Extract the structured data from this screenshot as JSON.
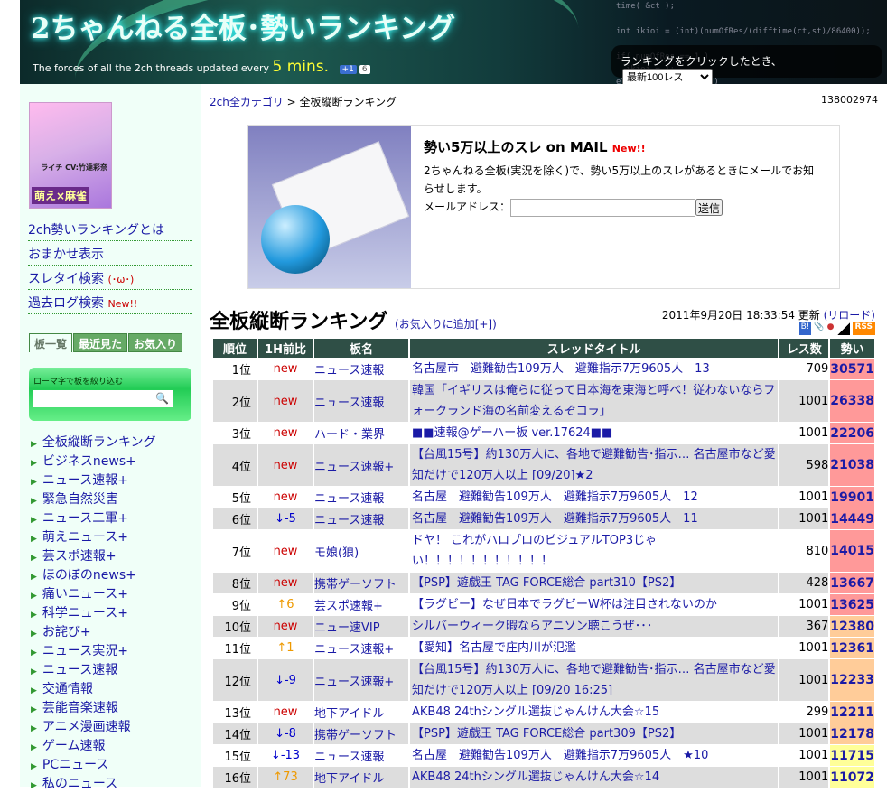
{
  "header": {
    "title": "2ちゃんねる全板･勢いランキング",
    "tagline_prefix": "The forces of all the 2ch threads updated every",
    "tagline_mins": "5 mins.",
    "gplus_label": "+1",
    "gplus_count": "6",
    "click_pref_label": "ランキングをクリックしたとき、",
    "click_pref_value": "最新100レス",
    "code": "time( &ct );\n\nint ikioi = (int)(numOfRes/(difftime(ct,st)/86400));\n\nif( numOfRes == 1 )\n  ikioi = 1;\nelse if( ikioi > 10 )\n  ikioi = ikioi > 10 ? 10 : ikioi;"
  },
  "sidebar": {
    "banner_text": "萌え×麻雀",
    "banner_cv": "ライチ CV:竹達彩奈",
    "links": [
      {
        "label": "2ch勢いランキングとは"
      },
      {
        "label": "おまかせ表示"
      },
      {
        "label": "スレタイ検索",
        "extra": "(･ω･)"
      },
      {
        "label": "過去ログ検索",
        "extra": "New!!"
      }
    ],
    "tabs": [
      "板一覧",
      "最近見た",
      "お気入り"
    ],
    "filter_label": "ローマ字で板を絞り込む",
    "boards": [
      "全板縦断ランキング",
      "ビジネスnews+",
      "ニュース速報+",
      "緊急自然災害",
      "ニュース二軍+",
      "萌えニュース+",
      "芸スポ速報+",
      "ほのぼのnews+",
      "痛いニュース+",
      "科学ニュース+",
      "お詫び+",
      "ニュース実況+",
      "ニュース速報",
      "交通情報",
      "芸能音楽速報",
      "アニメ漫画速報",
      "ゲーム速報",
      "PCニュース",
      "私のニュース"
    ]
  },
  "main": {
    "breadcrumb_link": "2ch全カテゴリ",
    "breadcrumb_sep": " > ",
    "breadcrumb_current": "全板縦断ランキング",
    "counter": "138002974",
    "mail": {
      "title": "勢い5万以上のスレ on MAIL",
      "new": "New!!",
      "desc": "2ちゃんねる全板(実況を除く)で、勢い5万以上のスレがあるときにメールでお知らせします。",
      "address_label": "メールアドレス：",
      "send": "送信"
    },
    "ranking_title": "全板縦断ランキング",
    "fav_link": "(お気入りに追加[+])",
    "updated": "2011年9月20日 18:33:54 更新",
    "reload": "(リロード)",
    "rss": "RSS",
    "columns": [
      "順位",
      "1H前比",
      "板名",
      "スレッドタイトル",
      "レス数",
      "勢い"
    ],
    "colors": {
      "pink": "#ff9999",
      "orange": "#ffcc99",
      "yellow": "#ffff99",
      "header": "#2f4f46"
    },
    "rows": [
      {
        "rank": "1位",
        "chg": "new",
        "board": "ニュース速報",
        "title": "名古屋市　避難勧告109万人　避難指示7万9605人　13",
        "res": "709",
        "ikioi": "30571"
      },
      {
        "rank": "2位",
        "chg": "new",
        "board": "ニュース速報",
        "title": "韓国「イギリスは俺らに従って日本海を東海と呼べ！従わないならフォークランド海の名前変えるぞコラ」",
        "res": "1001",
        "ikioi": "26338"
      },
      {
        "rank": "3位",
        "chg": "new",
        "board": "ハード・業界",
        "title": "■■速報@ゲーハー板 ver.17624■■",
        "res": "1001",
        "ikioi": "22206"
      },
      {
        "rank": "4位",
        "chg": "new",
        "board": "ニュース速報+",
        "title": "【台風15号】約130万人に、各地で避難勧告･指示… 名古屋市など愛知だけで120万人以上 [09/20]★2",
        "res": "598",
        "ikioi": "21038"
      },
      {
        "rank": "5位",
        "chg": "new",
        "board": "ニュース速報",
        "title": "名古屋　避難勧告109万人　避難指示7万9605人　12",
        "res": "1001",
        "ikioi": "19901"
      },
      {
        "rank": "6位",
        "chg": "↓-5",
        "board": "ニュース速報",
        "title": "名古屋　避難勧告109万人　避難指示7万9605人　11",
        "res": "1001",
        "ikioi": "14449"
      },
      {
        "rank": "7位",
        "chg": "new",
        "board": "モ娘(狼)",
        "title": "ドヤ！ これがハロプロのビジュアルTOP3じゃい！！！！！！！！！！！",
        "res": "810",
        "ikioi": "14015"
      },
      {
        "rank": "8位",
        "chg": "new",
        "board": "携帯ゲーソフト",
        "title": "【PSP】遊戯王 TAG FORCE総合 part310【PS2】",
        "res": "428",
        "ikioi": "13667"
      },
      {
        "rank": "9位",
        "chg": "↑6",
        "board": "芸スポ速報+",
        "title": "【ラグビー】なぜ日本でラグビーW杯は注目されないのか",
        "res": "1001",
        "ikioi": "13625"
      },
      {
        "rank": "10位",
        "chg": "new",
        "board": "ニュー速VIP",
        "title": "シルバーウィーク暇ならアニソン聴こうぜ･･･",
        "res": "367",
        "ikioi": "12380"
      },
      {
        "rank": "11位",
        "chg": "↑1",
        "board": "ニュース速報+",
        "title": "【愛知】名古屋で庄内川が氾濫",
        "res": "1001",
        "ikioi": "12361"
      },
      {
        "rank": "12位",
        "chg": "↓-9",
        "board": "ニュース速報+",
        "title": "【台風15号】約130万人に、各地で避難勧告･指示… 名古屋市など愛知だけで120万人以上 [09/20 16:25]",
        "res": "1001",
        "ikioi": "12233"
      },
      {
        "rank": "13位",
        "chg": "new",
        "board": "地下アイドル",
        "title": "AKB48 24thシングル選抜じゃんけん大会☆15",
        "res": "299",
        "ikioi": "12211"
      },
      {
        "rank": "14位",
        "chg": "↓-8",
        "board": "携帯ゲーソフト",
        "title": "【PSP】遊戯王 TAG FORCE総合 part309【PS2】",
        "res": "1001",
        "ikioi": "12178"
      },
      {
        "rank": "15位",
        "chg": "↓-13",
        "board": "ニュース速報",
        "title": "名古屋　避難勧告109万人　避難指示7万9605人　★10",
        "res": "1001",
        "ikioi": "11715"
      },
      {
        "rank": "16位",
        "chg": "↑73",
        "board": "地下アイドル",
        "title": "AKB48 24thシングル選抜じゃんけん大会☆14",
        "res": "1001",
        "ikioi": "11072"
      }
    ]
  }
}
